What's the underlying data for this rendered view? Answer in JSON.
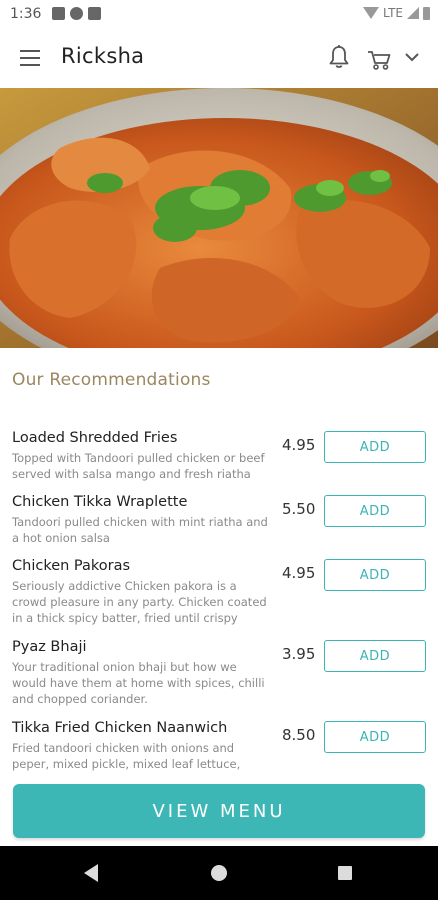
{
  "status_bar": {
    "time": "1:36",
    "network": "LTE"
  },
  "app_bar": {
    "title": "Ricksha"
  },
  "recommendations": {
    "title": "Our Recommendations",
    "items": [
      {
        "name": "Loaded Shredded Fries",
        "description": "Topped with Tandoori pulled chicken or beef served with salsa mango and fresh riatha",
        "price": "4.95",
        "button_label": "ADD"
      },
      {
        "name": "Chicken Tikka Wraplette",
        "description": "Tandoori pulled chicken with mint riatha and a hot onion salsa",
        "price": "5.50",
        "button_label": "ADD"
      },
      {
        "name": "Chicken Pakoras",
        "description": "Seriously addictive Chicken pakora is a crowd pleasure in any party. Chicken coated in a thick spicy batter, fried until crispy",
        "price": "4.95",
        "button_label": "ADD"
      },
      {
        "name": "Pyaz Bhaji",
        "description": "Your traditional onion bhaji but how we would have them at home with spices, chilli and chopped coriander.",
        "price": "3.95",
        "button_label": "ADD"
      },
      {
        "name": "Tikka Fried Chicken Naanwich",
        "description": "Fried tandoori chicken with onions and peper, mixed pickle, mixed leaf lettuce,",
        "price": "8.50",
        "button_label": "ADD"
      }
    ]
  },
  "view_menu_label": "VIEW MENU",
  "colors": {
    "accent": "#3cb7b5",
    "section_title": "#9b8660",
    "nav_bar": "#000000"
  },
  "icons": {
    "menu": "hamburger-icon",
    "notifications": "bell-icon",
    "cart": "cart-icon",
    "dropdown": "chevron-down-icon"
  }
}
